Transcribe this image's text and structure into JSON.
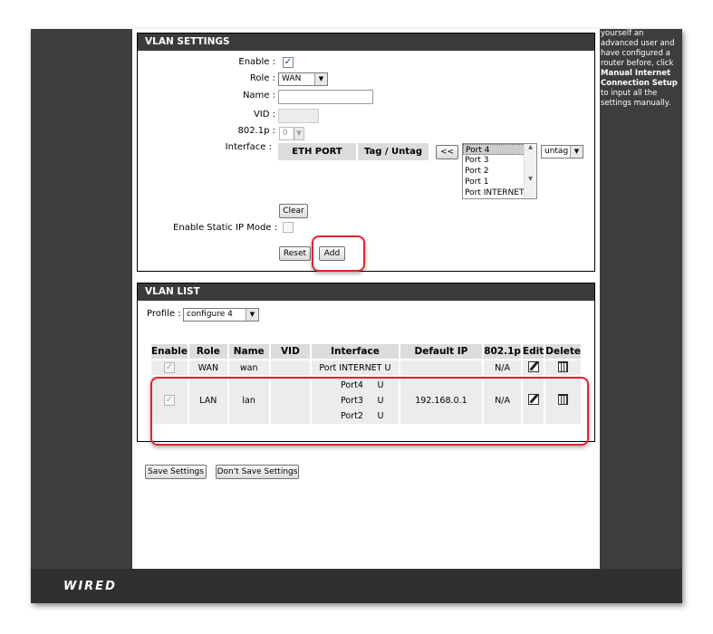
{
  "help": {
    "line1": "yourself an",
    "line2": "advanced user and",
    "line3": "have configured a",
    "line4": "router before, click",
    "bold1": "Manual Internet",
    "bold2": "Connection Setup",
    "line5": "to input all the",
    "line6": "settings manually."
  },
  "vlan_settings": {
    "title": "VLAN SETTINGS",
    "enable_label": "Enable :",
    "enable_checked": true,
    "role_label": "Role :",
    "role_value": "WAN",
    "name_label": "Name :",
    "name_value": "",
    "vid_label": "VID :",
    "vid_value": "",
    "p8021_label": "802.1p :",
    "p8021_value": "0",
    "interface_label": "Interface :",
    "col_eth_port": "ETH PORT",
    "col_tag_untag": "Tag / Untag",
    "move_button": "<<",
    "ports": [
      "Port 4",
      "Port 3",
      "Port 2",
      "Port 1",
      "Port INTERNET"
    ],
    "selected_port": "Port 4",
    "tag_value": "untag",
    "clear_button": "Clear",
    "static_ip_label": "Enable Static IP Mode :",
    "static_ip_checked": false,
    "reset_button": "Reset",
    "add_button": "Add"
  },
  "vlan_list": {
    "title": "VLAN LIST",
    "profile_label": "Profile :",
    "profile_value": "configure 4",
    "columns": [
      "Enable",
      "Role",
      "Name",
      "VID",
      "Interface",
      "Default IP",
      "802.1p",
      "Edit",
      "Delete"
    ],
    "rows": [
      {
        "enable": true,
        "role": "WAN",
        "name": "wan",
        "vid": "",
        "interfaces": [
          {
            "port": "Port INTERNET",
            "tag": "U"
          }
        ],
        "default_ip": "",
        "p8021": "N/A"
      },
      {
        "enable": true,
        "role": "LAN",
        "name": "lan",
        "vid": "",
        "interfaces": [
          {
            "port": "Port4",
            "tag": "U"
          },
          {
            "port": "Port3",
            "tag": "U"
          },
          {
            "port": "Port2",
            "tag": "U"
          }
        ],
        "default_ip": "192.168.0.1",
        "p8021": "N/A"
      }
    ]
  },
  "actions": {
    "save": "Save Settings",
    "dont_save": "Don't Save Settings"
  },
  "footer": {
    "logo": "WIRED"
  },
  "colors": {
    "dark_band": "#3b3e3b",
    "box_header": "#3b3b3b",
    "highlight": "#e0242e"
  }
}
